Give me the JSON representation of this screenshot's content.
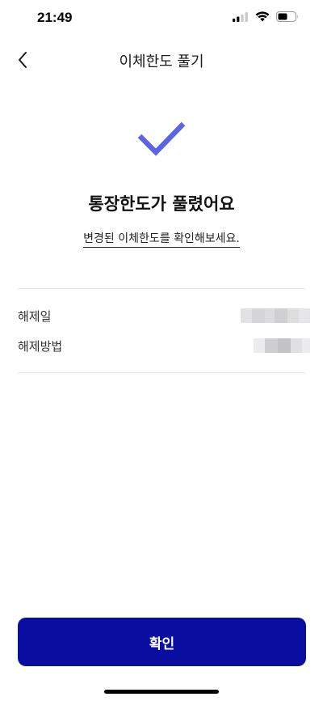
{
  "status_bar": {
    "time": "21:49",
    "signal_icon": "cellular-signal-icon",
    "wifi_icon": "wifi-icon",
    "battery_icon": "battery-icon",
    "battery_level": 0.55
  },
  "header": {
    "back_icon": "chevron-left-icon",
    "title": "이체한도 풀기"
  },
  "result": {
    "icon": "checkmark-icon",
    "icon_color": "#5b63e6",
    "title": "통장한도가 풀렸어요",
    "link_text": "변경된 이체한도를 확인해보세요."
  },
  "details": [
    {
      "label": "해제일",
      "value": ""
    },
    {
      "label": "해제방법",
      "value": ""
    }
  ],
  "footer": {
    "confirm_label": "확인",
    "button_color": "#0a0ea0"
  }
}
